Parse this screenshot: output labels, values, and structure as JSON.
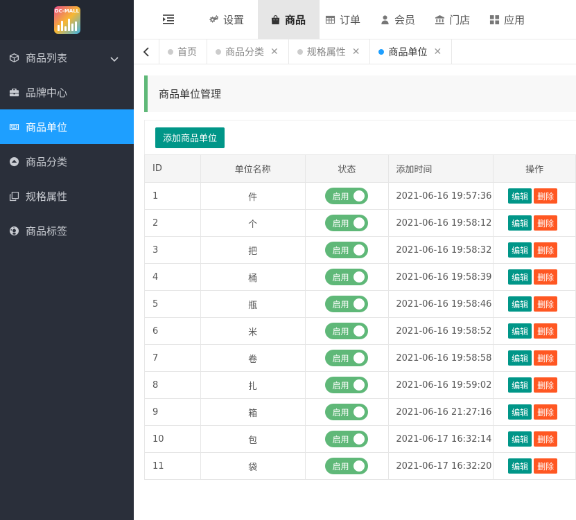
{
  "logo": {
    "text": "DC-MALL"
  },
  "sidebar": {
    "items": [
      {
        "label": "商品列表",
        "icon": "cube-icon",
        "has_children": true
      },
      {
        "label": "品牌中心",
        "icon": "briefcase-icon"
      },
      {
        "label": "商品单位",
        "icon": "keyboard-icon",
        "active": true
      },
      {
        "label": "商品分类",
        "icon": "up-circle-icon"
      },
      {
        "label": "规格属性",
        "icon": "clone-icon"
      },
      {
        "label": "商品标签",
        "icon": "soccer-ball-icon"
      }
    ]
  },
  "topnav": {
    "items": [
      {
        "label": "设置",
        "icon": "gears-icon"
      },
      {
        "label": "商品",
        "icon": "shopping-bag-icon",
        "active": true
      },
      {
        "label": "订单",
        "icon": "table-icon"
      },
      {
        "label": "会员",
        "icon": "user-icon"
      },
      {
        "label": "门店",
        "icon": "bank-icon"
      },
      {
        "label": "应用",
        "icon": "grid-icon"
      }
    ]
  },
  "tabs": [
    {
      "label": "首页",
      "closable": false
    },
    {
      "label": "商品分类",
      "closable": true
    },
    {
      "label": "规格属性",
      "closable": true
    },
    {
      "label": "商品单位",
      "closable": true,
      "active": true
    }
  ],
  "panel": {
    "title": "商品单位管理"
  },
  "toolbar": {
    "add_label": "添加商品单位"
  },
  "table": {
    "headers": {
      "id": "ID",
      "name": "单位名称",
      "status": "状态",
      "time": "添加时间",
      "ops": "操作"
    },
    "status_label": "启用",
    "edit_label": "编辑",
    "delete_label": "删除",
    "rows": [
      {
        "id": "1",
        "name": "件",
        "time": "2021-06-16 19:57:36"
      },
      {
        "id": "2",
        "name": "个",
        "time": "2021-06-16 19:58:12"
      },
      {
        "id": "3",
        "name": "把",
        "time": "2021-06-16 19:58:32"
      },
      {
        "id": "4",
        "name": "桶",
        "time": "2021-06-16 19:58:39"
      },
      {
        "id": "5",
        "name": "瓶",
        "time": "2021-06-16 19:58:46"
      },
      {
        "id": "6",
        "name": "米",
        "time": "2021-06-16 19:58:52"
      },
      {
        "id": "7",
        "name": "卷",
        "time": "2021-06-16 19:58:58"
      },
      {
        "id": "8",
        "name": "扎",
        "time": "2021-06-16 19:59:02"
      },
      {
        "id": "9",
        "name": "箱",
        "time": "2021-06-16 21:27:16"
      },
      {
        "id": "10",
        "name": "包",
        "time": "2021-06-17 16:32:14"
      },
      {
        "id": "11",
        "name": "袋",
        "time": "2021-06-17 16:32:20"
      }
    ]
  },
  "colors": {
    "sidebar_bg": "#2a2f3a",
    "active_blue": "#1e9fff",
    "teal": "#009688",
    "green": "#5fb878",
    "orange": "#ff5722"
  }
}
